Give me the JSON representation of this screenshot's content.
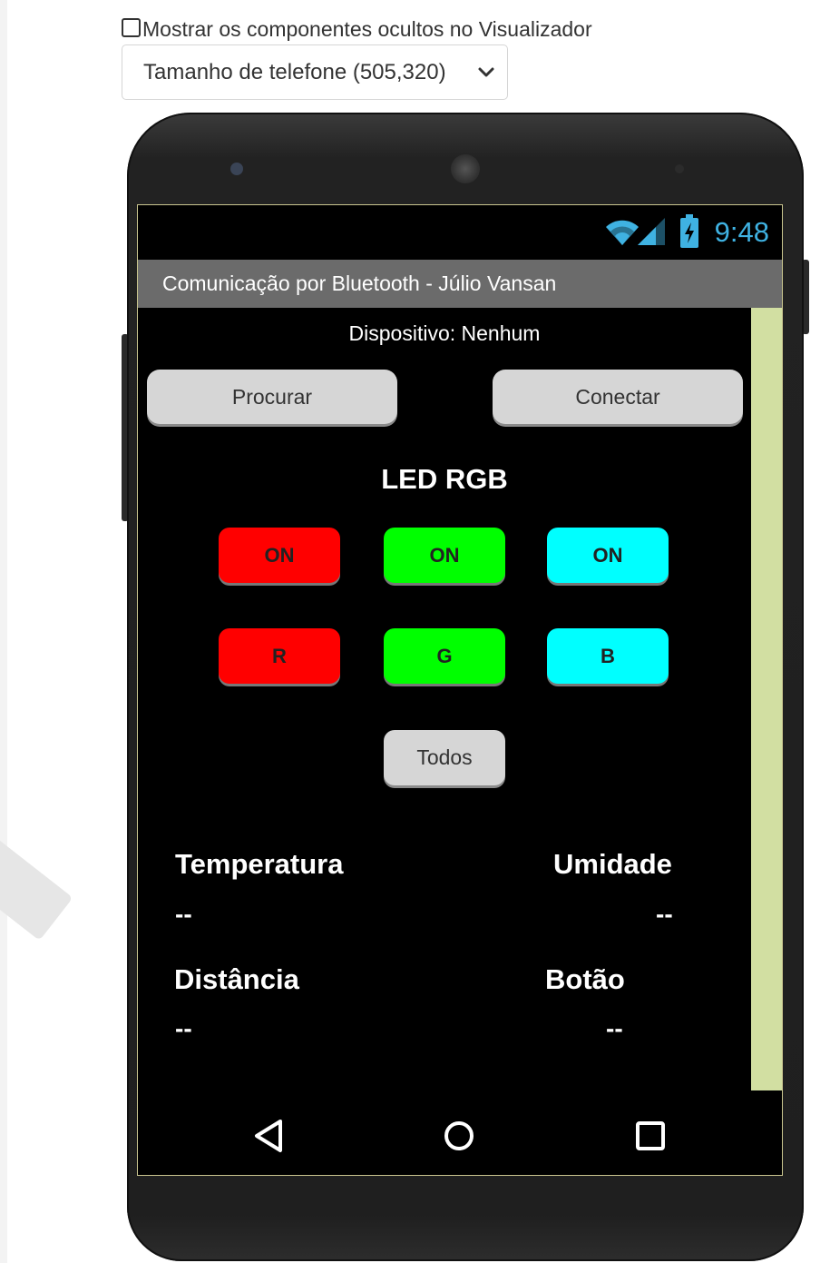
{
  "viewer": {
    "show_hidden_label": "Mostrar os componentes ocultos no Visualizador",
    "show_hidden_checked": false,
    "phone_size_selected": "Tamanho de telefone (505,320)"
  },
  "status_bar": {
    "time": "9:48"
  },
  "app": {
    "title": "Comunicação por Bluetooth - Júlio Vansan",
    "device_label": "Dispositivo: Nenhum",
    "search_button": "Procurar",
    "connect_button": "Conectar",
    "led_section_title": "LED RGB",
    "on_buttons": [
      "ON",
      "ON",
      "ON"
    ],
    "channel_buttons": [
      "R",
      "G",
      "B"
    ],
    "all_button": "Todos",
    "sensors": {
      "temperature_label": "Temperatura",
      "temperature_value": "--",
      "humidity_label": "Umidade",
      "humidity_value": "--",
      "distance_label": "Distância",
      "distance_value": "--",
      "button_label": "Botão",
      "button_value": "--"
    }
  },
  "colors": {
    "red": "#ff0000",
    "green": "#00ff00",
    "cyan": "#00ffff",
    "gray_button": "#d6d6d6",
    "title_bar": "#6b6b6b",
    "scrollbar": "#d2dfa2",
    "clock": "#3fb2e2"
  },
  "icons": {
    "status": [
      "wifi-icon",
      "signal-icon",
      "battery-charging-icon"
    ],
    "nav": [
      "back-icon",
      "home-icon",
      "recents-icon"
    ]
  }
}
